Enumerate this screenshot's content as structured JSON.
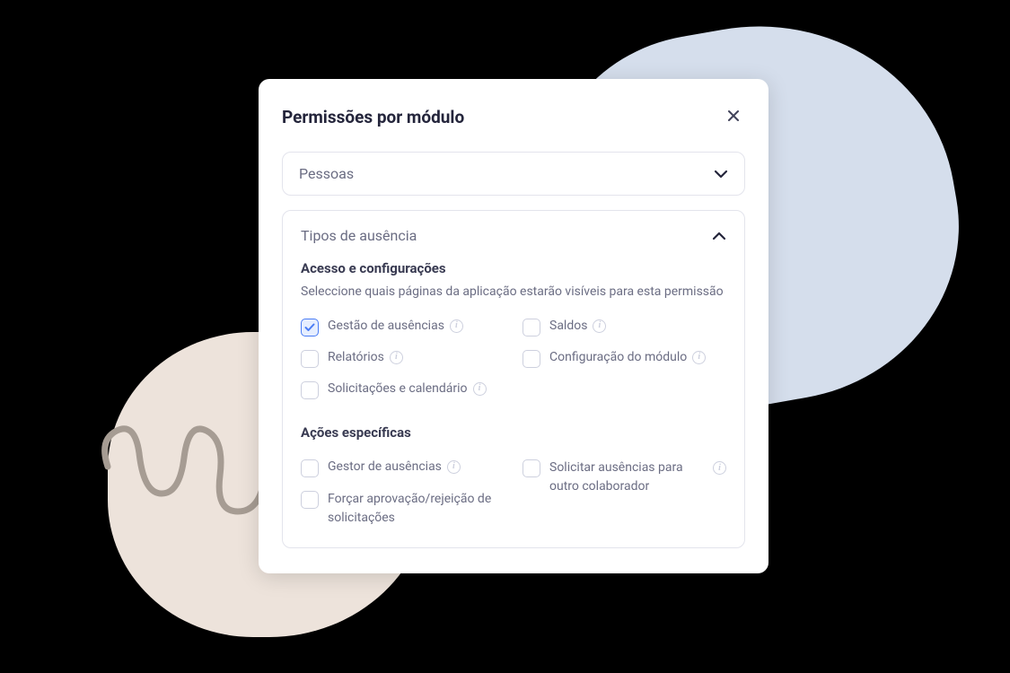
{
  "modal": {
    "title": "Permissões por módulo",
    "select": {
      "value": "Pessoas"
    },
    "accordion": {
      "title": "Tipos de ausência",
      "section1": {
        "title": "Acesso e configurações",
        "description": "Seleccione quais páginas da aplicação estarão visíveis para esta permissão",
        "checkboxes": [
          {
            "label": "Gestão de ausências",
            "checked": true,
            "hasInfo": true
          },
          {
            "label": "Saldos",
            "checked": false,
            "hasInfo": true
          },
          {
            "label": "Relatórios",
            "checked": false,
            "hasInfo": true
          },
          {
            "label": "Configuração do módulo",
            "checked": false,
            "hasInfo": true
          },
          {
            "label": "Solicitações e calendário",
            "checked": false,
            "hasInfo": true
          }
        ]
      },
      "section2": {
        "title": "Ações específicas",
        "checkboxes": [
          {
            "label": "Gestor de ausências",
            "checked": false,
            "hasInfo": true
          },
          {
            "label": "Solicitar ausências para outro colaborador",
            "checked": false,
            "hasInfo": true
          },
          {
            "label": "Forçar aprovação/rejeição de solicitações",
            "checked": false,
            "hasInfo": false
          }
        ]
      }
    }
  }
}
